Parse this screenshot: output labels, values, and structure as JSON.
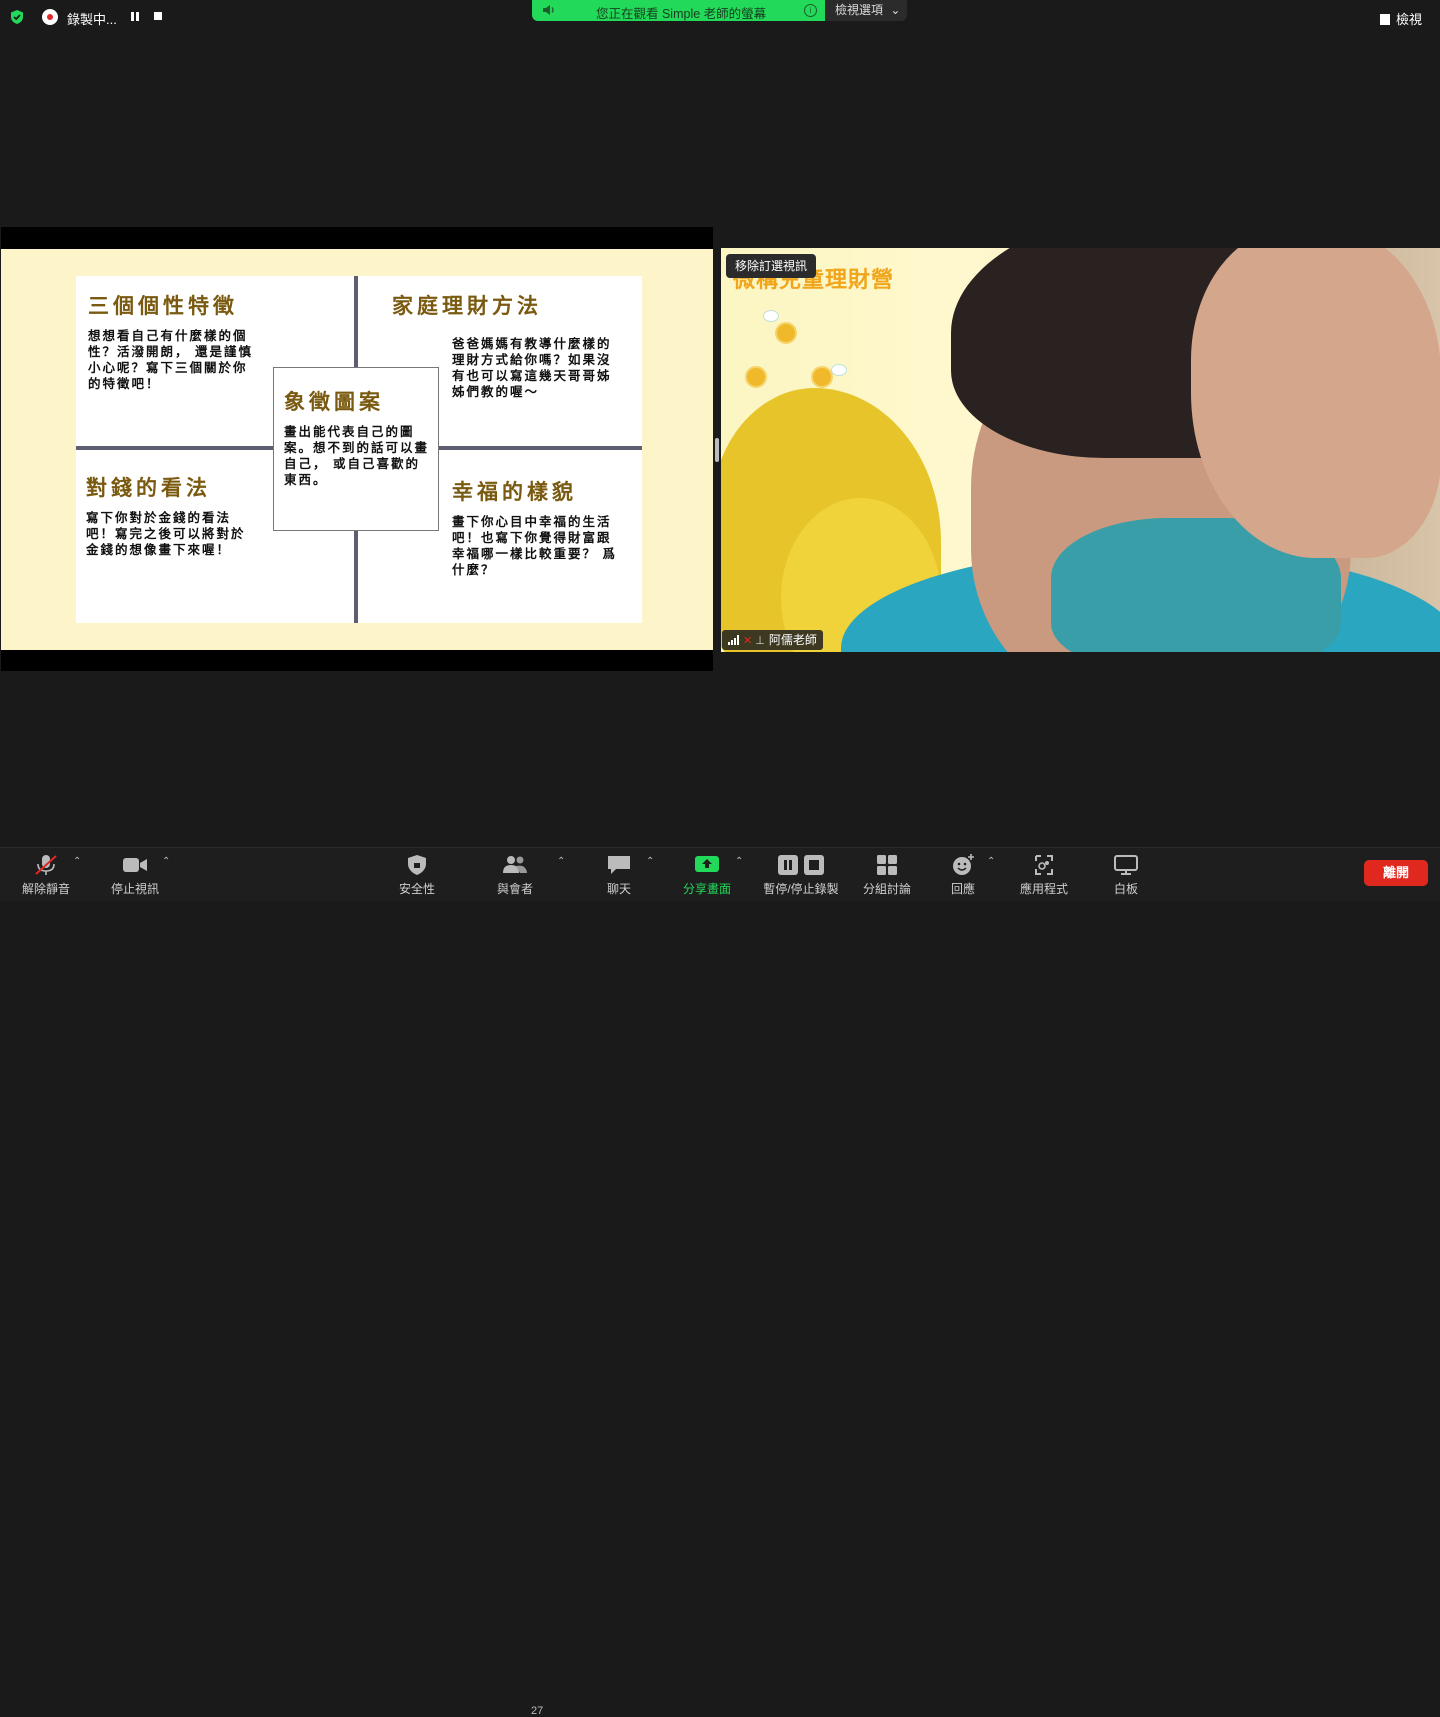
{
  "topbar": {
    "recording_label": "錄製中...",
    "share_banner_text": "您正在觀看 Simple 老師的螢幕",
    "view_options_label": "檢視選項",
    "view_label": "檢視"
  },
  "slide": {
    "q1": {
      "title": "三個個性特徵",
      "body": "想想看自己有什麼樣的個性？活潑開朗， 還是謹慎小心呢？寫下三個關於你的特徵吧！"
    },
    "q2": {
      "title": "家庭理財方法",
      "body": "爸爸媽媽有教導什麼樣的理財方式給你嗎？如果沒有也可以寫這幾天哥哥姊姊們教的喔～"
    },
    "q3": {
      "title": "象徵圖案",
      "body": "畫出能代表自己的圖案。想不到的話可以畫自己， 或自己喜歡的東西。"
    },
    "q4": {
      "title": "對錢的看法",
      "body": "寫下你對於金錢的看法吧！寫完之後可以將對於金錢的想像畫下來喔！"
    },
    "q5": {
      "title": "幸福的樣貌",
      "body": "畫下你心目中幸福的生活吧！也寫下你覺得財富跟幸福哪一樣比較重要？ 爲什麼？"
    }
  },
  "video": {
    "unpin_label": "移除訂選視訊",
    "background_title": "微構兒童理財營",
    "participant_name": "阿儒老師"
  },
  "toolbar": {
    "unmute": "解除靜音",
    "stop_video": "停止視訊",
    "security": "安全性",
    "participants": "與會者",
    "participant_count": "27",
    "chat": "聊天",
    "share_screen": "分享畫面",
    "pause_recording": "暫停/停止錄製",
    "breakout": "分組討論",
    "reactions": "回應",
    "apps": "應用程式",
    "whiteboard": "白板",
    "leave": "離開"
  },
  "colors": {
    "accent_green": "#23d959",
    "leave_red": "#e0281f",
    "slide_bg": "#fdf5c9",
    "heading_brown": "#7a5a10"
  }
}
